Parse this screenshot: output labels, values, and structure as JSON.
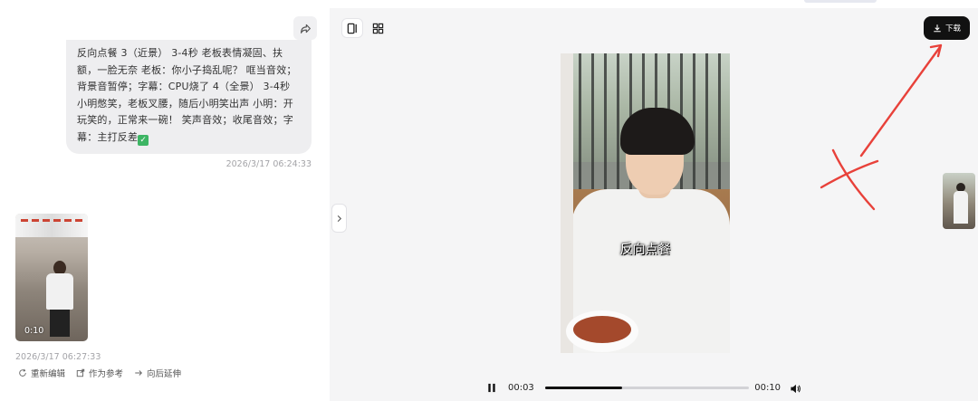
{
  "chat": {
    "message_text": "反向点餐 3（近景） 3-4秒 老板表情凝固、扶额，一脸无奈 老板：你小子捣乱呢？ 哐当音效；背景音暂停；字幕：CPU烧了 4（全景） 3-4秒 小明憋笑，老板叉腰，随后小明笑出声 小明：开玩笑的，正常来一碗！ 笑声音效；收尾音效；字幕：主打反差",
    "message_emoji": "✓",
    "message_timestamp": "2026/3/17 06:24:33",
    "video_thumb_duration": "0:10",
    "video_timestamp": "2026/3/17 06:27:33",
    "actions": [
      {
        "label": "重新编辑",
        "icon": "refresh-icon"
      },
      {
        "label": "作为参考",
        "icon": "external-link-icon"
      },
      {
        "label": "向后延伸",
        "icon": "arrow-right-icon"
      }
    ]
  },
  "preview": {
    "download_label": "下载",
    "caption": "反向点餐",
    "current_time": "00:03",
    "total_time": "00:10",
    "progress": 0.38,
    "view_modes": [
      "single-view-icon",
      "grid-view-icon"
    ]
  },
  "colors": {
    "bubble_bg": "#eeeef0",
    "preview_bg": "#f5f5f6",
    "download_bg": "#111111",
    "annotation_red": "#e8413a"
  }
}
